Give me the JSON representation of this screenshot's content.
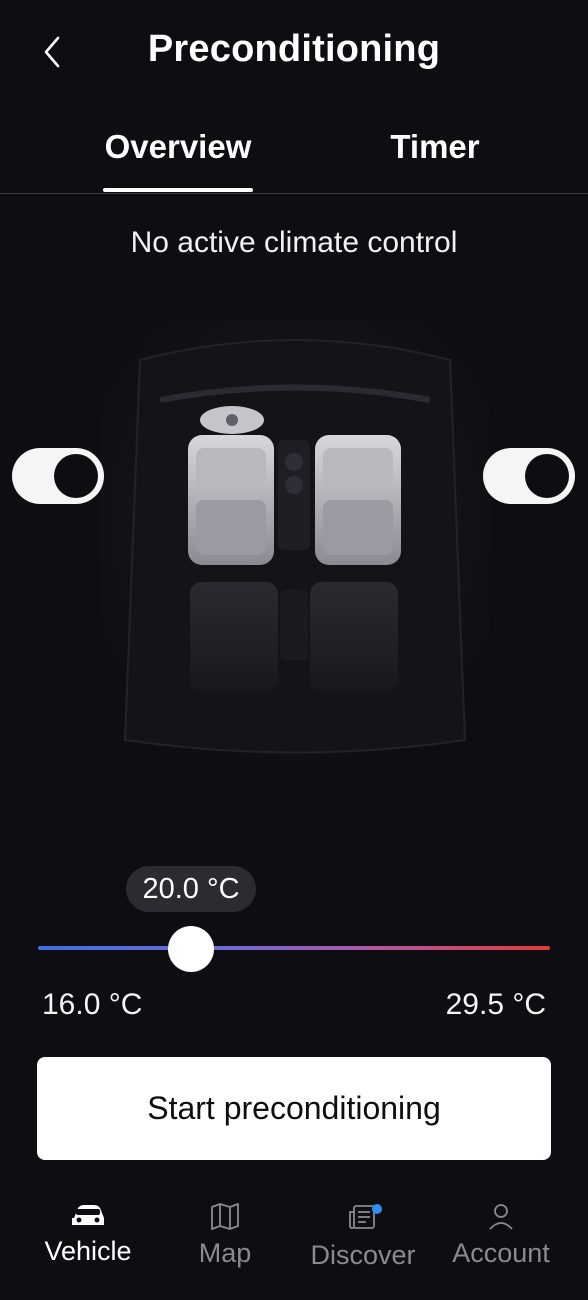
{
  "header": {
    "title": "Preconditioning"
  },
  "tabs": [
    {
      "label": "Overview",
      "active": true
    },
    {
      "label": "Timer",
      "active": false
    }
  ],
  "status_text": "No active climate control",
  "seat_toggles": {
    "left": {
      "state": "on"
    },
    "right": {
      "state": "on"
    }
  },
  "temperature": {
    "current": "20.0 °C",
    "min": "16.0 °C",
    "max": "29.5 °C",
    "gradient_start": "#3f6fe0",
    "gradient_end": "#e23a3a"
  },
  "primary_action": {
    "label": "Start preconditioning"
  },
  "bottom_nav": [
    {
      "label": "Vehicle",
      "icon": "car-icon",
      "active": true
    },
    {
      "label": "Map",
      "icon": "map-icon",
      "active": false
    },
    {
      "label": "Discover",
      "icon": "news-icon",
      "active": false,
      "badge": true
    },
    {
      "label": "Account",
      "icon": "person-icon",
      "active": false
    }
  ],
  "colors": {
    "background": "#0e0e12",
    "text": "#ffffff",
    "inactive_nav": "#8a8a92",
    "badge": "#2f8df7"
  }
}
